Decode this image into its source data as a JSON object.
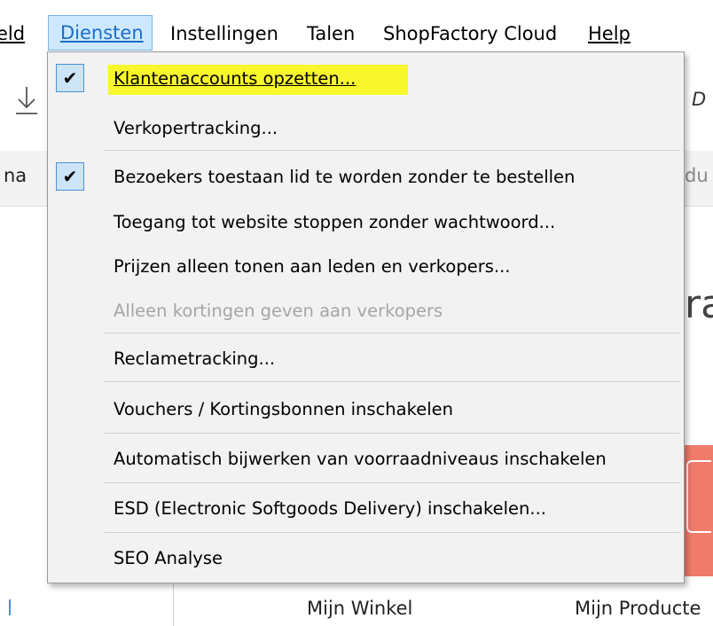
{
  "menubar": {
    "items": [
      {
        "label": "eld",
        "u": true
      },
      {
        "label": "Diensten"
      },
      {
        "label": "Instellingen"
      },
      {
        "label": "Talen"
      },
      {
        "label": "ShopFactory Cloud"
      },
      {
        "label": "Help"
      }
    ]
  },
  "background": {
    "strip_left": "na",
    "strip_right": "du",
    "big_fragment": "ra",
    "mijn_winkel": "Mijn Winkel",
    "mijn_producten": "Mijn Producte",
    "toolbar_right": "D"
  },
  "menu": {
    "items": [
      {
        "label": "Klantenaccounts opzetten...",
        "checked": true,
        "highlighted": true
      },
      {
        "label": "Verkopertracking..."
      },
      {
        "label": "Bezoekers toestaan lid te worden zonder te bestellen",
        "checked": true
      },
      {
        "label": "Toegang tot website stoppen zonder wachtwoord..."
      },
      {
        "label": "Prijzen alleen tonen aan leden en verkopers..."
      },
      {
        "label": "Alleen kortingen geven aan verkopers",
        "disabled": true
      },
      {
        "label": "Reclametracking..."
      },
      {
        "label": "Vouchers / Kortingsbonnen inschakelen"
      },
      {
        "label": "Automatisch bijwerken van voorraadniveaus inschakelen"
      },
      {
        "label": "ESD (Electronic Softgoods Delivery) inschakelen..."
      },
      {
        "label": "SEO Analyse"
      }
    ],
    "check_glyph": "✔"
  },
  "colors": {
    "highlight": "#f7f72c",
    "menu_active": "#cde8ff",
    "accent_orange": "#ef7b6b"
  }
}
